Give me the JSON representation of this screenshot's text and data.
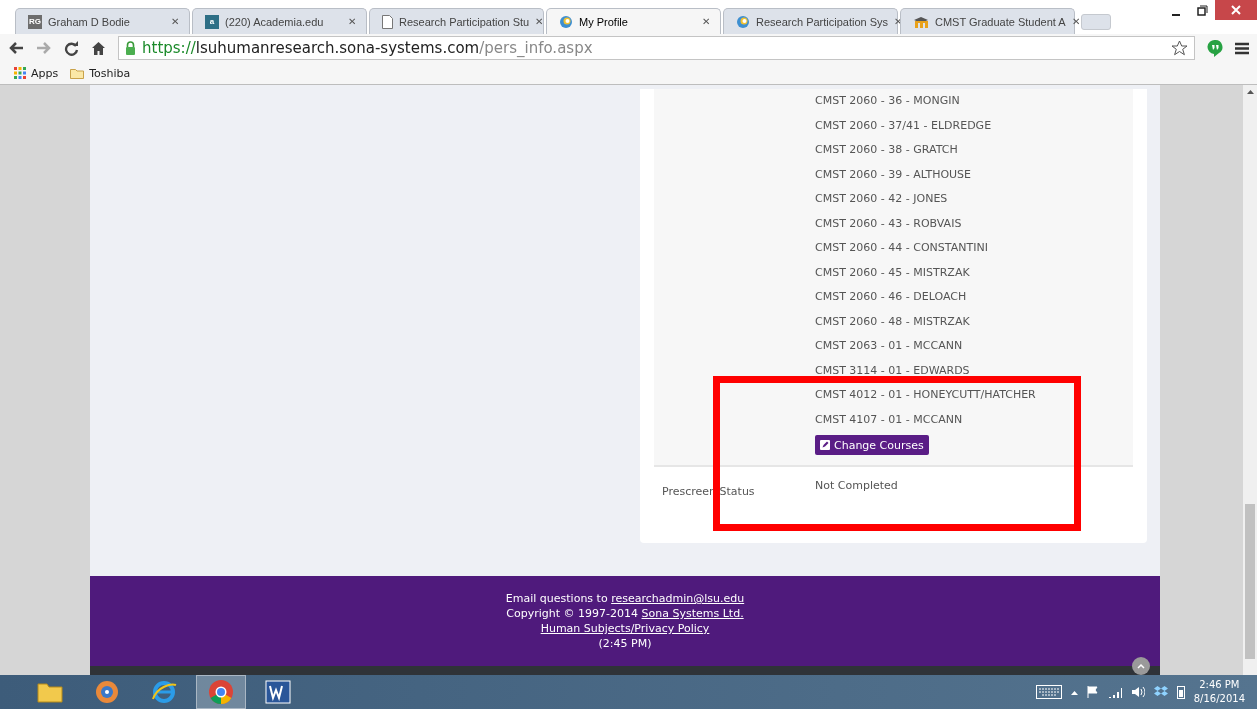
{
  "browser": {
    "tabs": [
      {
        "title": "Graham D Bodie",
        "kind": "badge",
        "icon_text": "RG",
        "close": "✕",
        "selected": false
      },
      {
        "title": "(220) Academia.edu",
        "kind": "badge",
        "icon_text": "a",
        "close": "✕",
        "selected": false
      },
      {
        "title": "Research Participation Stu",
        "kind": "page",
        "close": "✕",
        "selected": false
      },
      {
        "title": "My Profile",
        "kind": "swirl",
        "close": "✕",
        "selected": true
      },
      {
        "title": "Research Participation Sys",
        "kind": "swirl",
        "close": "✕",
        "selected": false
      },
      {
        "title": "CMST Graduate Student A",
        "kind": "cap",
        "close": "✕",
        "selected": false
      }
    ],
    "url_scheme": "https://",
    "url_host": "lsuhumanresearch.sona-systems.com",
    "url_path": "/pers_info.aspx",
    "bookmarks": [
      {
        "label": "Apps",
        "kind": "grid"
      },
      {
        "label": "Toshiba",
        "kind": "folder"
      }
    ]
  },
  "profile": {
    "courses": [
      "CMST 2060 - 36 - MONGIN",
      "CMST 2060 - 37/41 - ELDREDGE",
      "CMST 2060 - 38 - GRATCH",
      "CMST 2060 - 39 - ALTHOUSE",
      "CMST 2060 - 42 - JONES",
      "CMST 2060 - 43 - ROBVAIS",
      "CMST 2060 - 44 - CONSTANTINI",
      "CMST 2060 - 45 - MISTRZAK",
      "CMST 2060 - 46 - DELOACH",
      "CMST 2060 - 48 - MISTRZAK",
      "CMST 2063 - 01 - MCCANN",
      "CMST 3114 - 01 - EDWARDS",
      "CMST 4012 - 01 - HONEYCUTT/HATCHER",
      "CMST 4107 - 01 - MCCANN"
    ],
    "change_courses_button": "Change Courses",
    "fields": [
      {
        "label": "Prescreen Status",
        "value": "Not Completed"
      }
    ]
  },
  "footer": {
    "email_text": "Email questions to ",
    "email_link": "researchadmin@lsu.edu",
    "copyright_text": "Copyright © 1997-2014 ",
    "company_link": "Sona Systems Ltd.",
    "policy_link": "Human Subjects/Privacy Policy",
    "time": "(2:45 PM)"
  },
  "taskbar": {
    "apps": [
      {
        "kind": "folder",
        "selected": false
      },
      {
        "kind": "disc",
        "selected": false
      },
      {
        "kind": "ie",
        "selected": false
      },
      {
        "kind": "chrome",
        "selected": true
      },
      {
        "kind": "word",
        "selected": false
      }
    ],
    "time": "2:46 PM",
    "date": "8/16/2014"
  }
}
